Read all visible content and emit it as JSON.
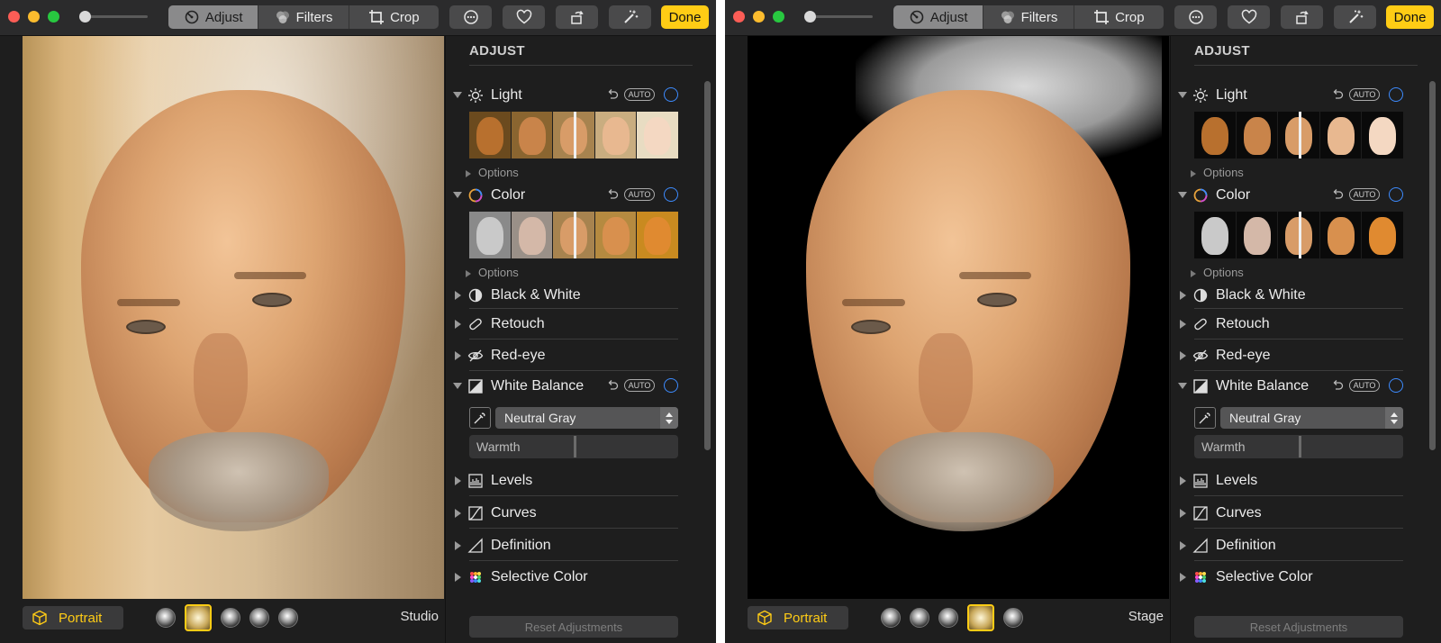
{
  "windows": [
    {
      "toolbar": {
        "adjust": "Adjust",
        "filters": "Filters",
        "crop": "Crop",
        "done": "Done"
      },
      "photo": {
        "mode": "Portrait",
        "lighting_preset": "Studio",
        "selected_light_index": 1
      },
      "panel": {
        "title": "ADJUST",
        "light": {
          "label": "Light",
          "auto": "AUTO",
          "options": "Options"
        },
        "color": {
          "label": "Color",
          "auto": "AUTO",
          "options": "Options"
        },
        "bw": {
          "label": "Black & White"
        },
        "retouch": {
          "label": "Retouch"
        },
        "redeye": {
          "label": "Red-eye"
        },
        "wb": {
          "label": "White Balance",
          "auto": "AUTO",
          "mode": "Neutral Gray",
          "warmth_label": "Warmth",
          "warmth_value": 0.5
        },
        "levels": {
          "label": "Levels"
        },
        "curves": {
          "label": "Curves"
        },
        "definition": {
          "label": "Definition"
        },
        "selective": {
          "label": "Selective Color"
        },
        "reset": "Reset Adjustments"
      }
    },
    {
      "toolbar": {
        "adjust": "Adjust",
        "filters": "Filters",
        "crop": "Crop",
        "done": "Done"
      },
      "photo": {
        "mode": "Portrait",
        "lighting_preset": "Stage",
        "selected_light_index": 3
      },
      "panel": {
        "title": "ADJUST",
        "light": {
          "label": "Light",
          "auto": "AUTO",
          "options": "Options"
        },
        "color": {
          "label": "Color",
          "auto": "AUTO",
          "options": "Options"
        },
        "bw": {
          "label": "Black & White"
        },
        "retouch": {
          "label": "Retouch"
        },
        "redeye": {
          "label": "Red-eye"
        },
        "wb": {
          "label": "White Balance",
          "auto": "AUTO",
          "mode": "Neutral Gray",
          "warmth_label": "Warmth",
          "warmth_value": 0.5
        },
        "levels": {
          "label": "Levels"
        },
        "curves": {
          "label": "Curves"
        },
        "definition": {
          "label": "Definition"
        },
        "selective": {
          "label": "Selective Color"
        },
        "reset": "Reset Adjustments"
      }
    }
  ],
  "colors": {
    "accent": "#ffcc15",
    "ring": "#3d8bff",
    "panel_bg": "#1e1e1e",
    "toolbar_bg": "#2b2b2c"
  }
}
